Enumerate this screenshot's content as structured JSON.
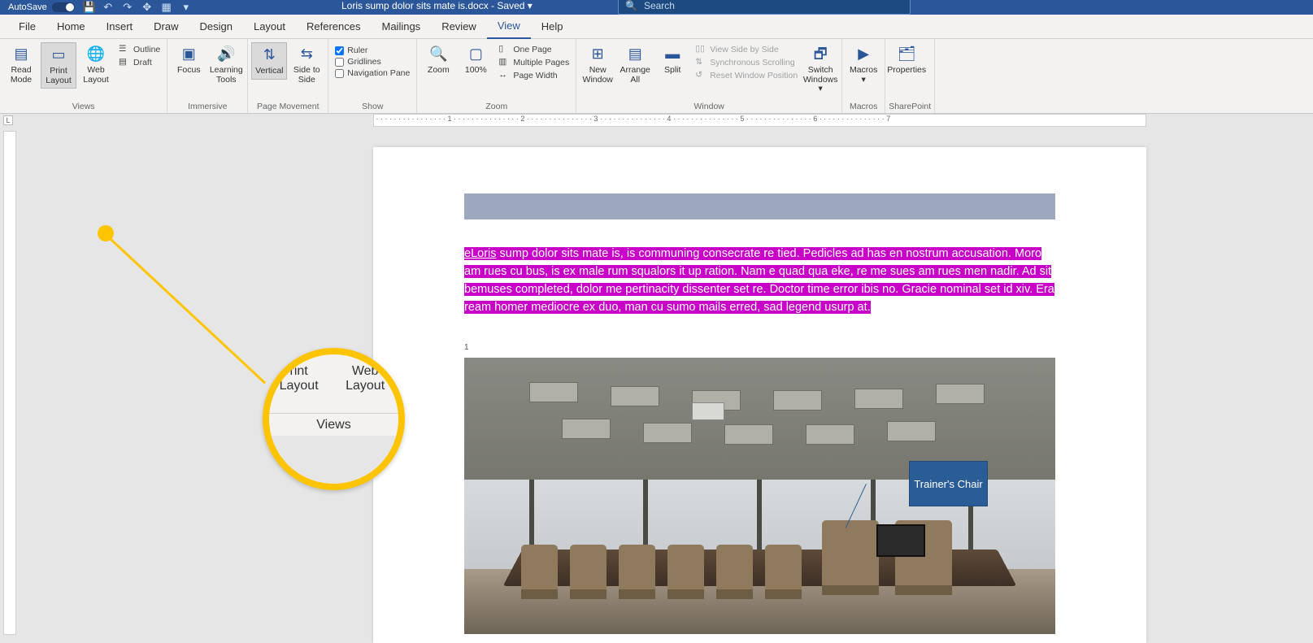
{
  "titlebar": {
    "autosave": "AutoSave",
    "doc": "Loris sump dolor sits mate is.docx - Saved ▾",
    "search_placeholder": "Search"
  },
  "tabs": [
    "File",
    "Home",
    "Insert",
    "Draw",
    "Design",
    "Layout",
    "References",
    "Mailings",
    "Review",
    "View",
    "Help"
  ],
  "active_tab": 9,
  "ribbon_groups": {
    "views": {
      "label": "Views",
      "read_mode": "Read Mode",
      "print_layout": "Print Layout",
      "web_layout": "Web Layout",
      "outline": "Outline",
      "draft": "Draft"
    },
    "immersive": {
      "label": "Immersive",
      "focus": "Focus",
      "learning_tools": "Learning Tools"
    },
    "page_movement": {
      "label": "Page Movement",
      "vertical": "Vertical",
      "side": "Side to Side"
    },
    "show": {
      "label": "Show",
      "ruler": "Ruler",
      "gridlines": "Gridlines",
      "nav": "Navigation Pane"
    },
    "zoom": {
      "label": "Zoom",
      "zoom": "Zoom",
      "pct": "100%",
      "one": "One Page",
      "multi": "Multiple Pages",
      "width": "Page Width"
    },
    "window": {
      "label": "Window",
      "new": "New Window",
      "arrange": "Arrange All",
      "split": "Split",
      "side_by_side": "View Side by Side",
      "sync": "Synchronous Scrolling",
      "reset": "Reset Window Position",
      "switch": "Switch Windows ▾"
    },
    "macros": {
      "label": "Macros",
      "macros": "Macros ▾"
    },
    "sharepoint": {
      "label": "SharePoint",
      "properties": "Properties"
    }
  },
  "document": {
    "paragraph_link": "eLoris",
    "paragraph_rest": " sump dolor sits mate is, is communing consecrate re tied. Pedicles ad has en nostrum accusation. Moro am rues cu bus, is ex male rum squalors it up ration. Nam e quad qua eke, re me sues am rues men nadir. Ad sit bemuses completed, dolor me pertinacity dissenter set re. Doctor time error ibis no. Gracie nominal set id xiv. Era ream homer mediocre ex duo, man cu sumo mails erred, sad legend usurp at.",
    "footnote": "1",
    "callout": "Trainer's Chair"
  },
  "lens": {
    "print": "rint Layout",
    "web": "Web Layout",
    "views": "Views"
  },
  "ruler_ticks": [
    "1",
    "2",
    "3",
    "4",
    "5",
    "6",
    "7"
  ]
}
